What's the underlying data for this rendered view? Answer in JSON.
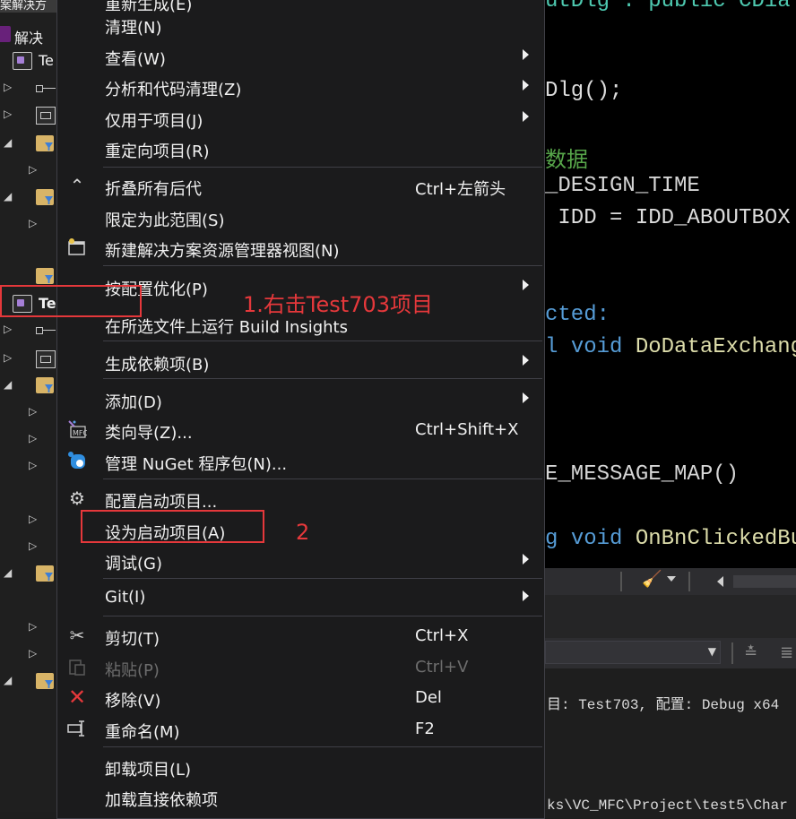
{
  "explorer": {
    "top_fragment": "案解决方",
    "solution_label": "解决",
    "project_label_1": "Te",
    "project_label_2": "Te"
  },
  "menu": {
    "partial_top": "重新生成(E)",
    "items": [
      {
        "label": "清理(N)"
      },
      {
        "label": "查看(W)",
        "submenu": true
      },
      {
        "label": "分析和代码清理(Z)",
        "submenu": true
      },
      {
        "label": "仅用于项目(J)",
        "submenu": true
      },
      {
        "label": "重定向项目(R)"
      },
      {
        "label": "折叠所有后代",
        "shortcut": "Ctrl+左箭头",
        "icon": "collapse-icon"
      },
      {
        "label": "限定为此范围(S)"
      },
      {
        "label": "新建解决方案资源管理器视图(N)",
        "icon": "new-view-icon"
      },
      {
        "label": "按配置优化(P)",
        "submenu": true
      },
      {
        "label": "在所选文件上运行 Build Insights"
      },
      {
        "label": "生成依赖项(B)",
        "submenu": true
      },
      {
        "label": "添加(D)",
        "submenu": true
      },
      {
        "label": "类向导(Z)...",
        "shortcut": "Ctrl+Shift+X",
        "icon": "class-wizard-icon"
      },
      {
        "label": "管理 NuGet 程序包(N)...",
        "icon": "nuget-icon"
      },
      {
        "label": "配置启动项目...",
        "icon": "gear-icon"
      },
      {
        "label": "设为启动项目(A)"
      },
      {
        "label": "调试(G)",
        "submenu": true
      },
      {
        "label": "Git(I)",
        "submenu": true
      },
      {
        "label": "剪切(T)",
        "shortcut": "Ctrl+X",
        "icon": "cut-icon"
      },
      {
        "label": "粘贴(P)",
        "shortcut": "Ctrl+V",
        "icon": "paste-icon",
        "disabled": true
      },
      {
        "label": "移除(V)",
        "shortcut": "Del",
        "icon": "remove-icon"
      },
      {
        "label": "重命名(M)",
        "shortcut": "F2",
        "icon": "rename-icon"
      },
      {
        "label": "卸载项目(L)"
      },
      {
        "label": "加载直接依赖项"
      }
    ]
  },
  "editor": {
    "lines": [
      {
        "parts": [
          {
            "t": "utDlg : public CDial",
            "c": "pl"
          }
        ]
      },
      {
        "parts": [
          {
            "t": "Dlg();",
            "c": "pl"
          }
        ]
      },
      {
        "parts": [
          {
            "t": "数据",
            "c": "cm"
          }
        ]
      },
      {
        "parts": [
          {
            "t": "_DESIGN_TIME",
            "c": "mc"
          }
        ]
      },
      {
        "parts": [
          {
            "t": " IDD = IDD_ABOUTBOX",
            "c": "pl"
          }
        ]
      },
      {
        "parts": [
          {
            "t": "cted:",
            "c": "kw"
          }
        ]
      },
      {
        "parts": [
          {
            "t": "l ",
            "c": "kw"
          },
          {
            "t": "void ",
            "c": "kw"
          },
          {
            "t": "DoDataExchang",
            "c": "fn"
          }
        ]
      },
      {
        "parts": [
          {
            "t": "E_MESSAGE_MAP()",
            "c": "mc"
          }
        ]
      },
      {
        "parts": [
          {
            "t": "g ",
            "c": "kw"
          },
          {
            "t": "void ",
            "c": "kw"
          },
          {
            "t": "OnBnClickedBu",
            "c": "fn"
          }
        ]
      }
    ]
  },
  "output": {
    "line1": "目: Test703, 配置: Debug x64",
    "line2": "ks\\VC_MFC\\Project\\test5\\Char"
  },
  "annotations": {
    "step1": "1.右击Test703项目",
    "step2": "2"
  },
  "colors": {
    "annotation": "#e5383b",
    "menu_bg": "#1b1b1c",
    "editor_bg": "#000000"
  }
}
